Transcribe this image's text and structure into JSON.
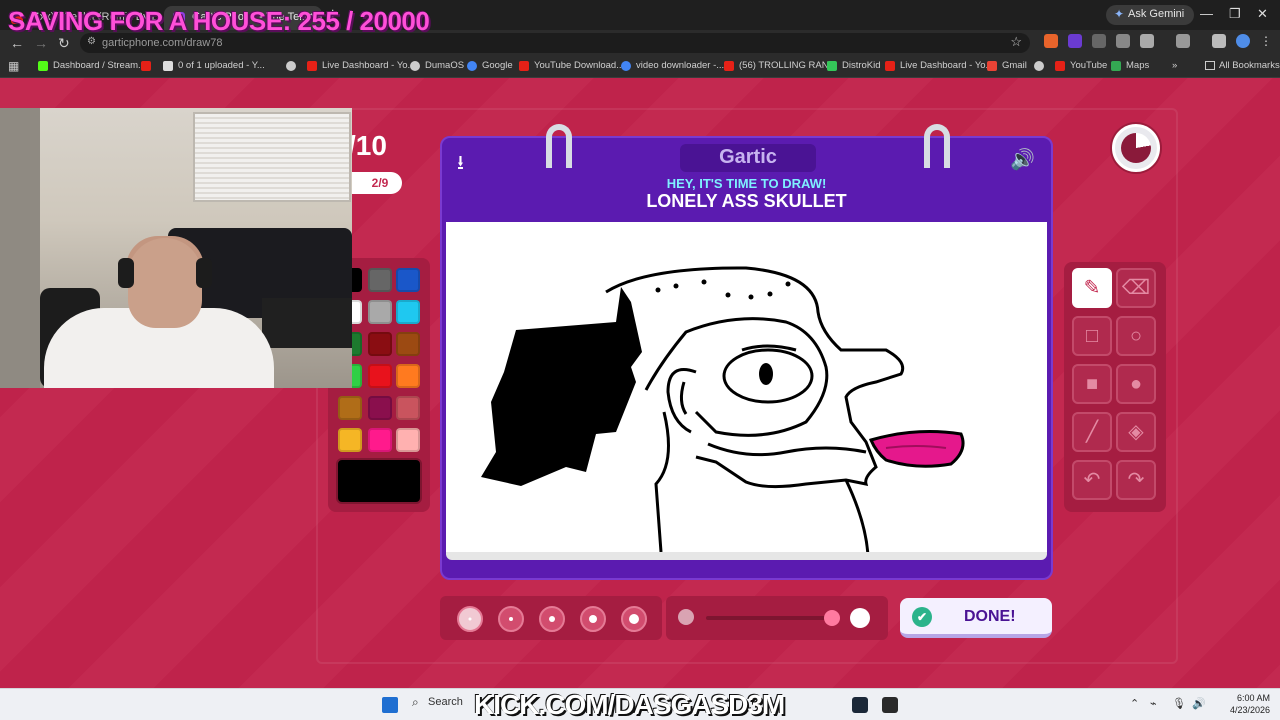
{
  "overlay": {
    "title": "SAVING FOR A HOUSE: 255 / 20000"
  },
  "browser": {
    "tabs": [
      {
        "label": "(4xx) - Feel It (Remix By L...",
        "active": false
      },
      {
        "label": "Gartic Phone - The Telepho...",
        "active": true
      }
    ],
    "ask_gemini": "Ask Gemini",
    "url": "garticphone.com/draw78",
    "bookmarks": [
      "Dashboard / Stream...",
      "0 of 1 uploaded - Y...",
      "Live Dashboard - Yo...",
      "DumaOS",
      "Google",
      "YouTube Download...",
      "video downloader -...",
      "(56) TROLLING RAN...",
      "DistroKid",
      "Live Dashboard - Yo...",
      "Gmail",
      "YouTube",
      "Maps"
    ],
    "all_bookmarks": "All Bookmarks"
  },
  "game": {
    "round": "/10",
    "players": "2/9",
    "logo": "Gartic",
    "instruction": "HEY, IT'S TIME TO DRAW!",
    "prompt": "LONELY ASS SKULLET",
    "done_label": "DONE!",
    "palette": [
      "#000000",
      "#666666",
      "#1a57c9",
      "#ffffff",
      "#a9a9a9",
      "#1fc8f0",
      "#1d7a2e",
      "#8a0d12",
      "#9c4a12",
      "#2fd045",
      "#e8121c",
      "#ff7a1f",
      "#b06d18",
      "#8a0f4d",
      "#c9545e",
      "#f5b625",
      "#ff1a8c",
      "#ffb1b0"
    ],
    "current_color": "#000000",
    "tools": [
      "pencil-icon",
      "eraser-icon",
      "rectangle-outline-icon",
      "circle-outline-icon",
      "rectangle-fill-icon",
      "circle-fill-icon",
      "line-icon",
      "bucket-icon",
      "undo-icon",
      "redo-icon"
    ],
    "brush_sizes": 5,
    "selected_size": 0
  },
  "taskbar": {
    "search": "Search",
    "stream_overlay": "KICK.COM/DASGASD3M",
    "time": "6:00 AM",
    "date": "4/23/2026"
  }
}
